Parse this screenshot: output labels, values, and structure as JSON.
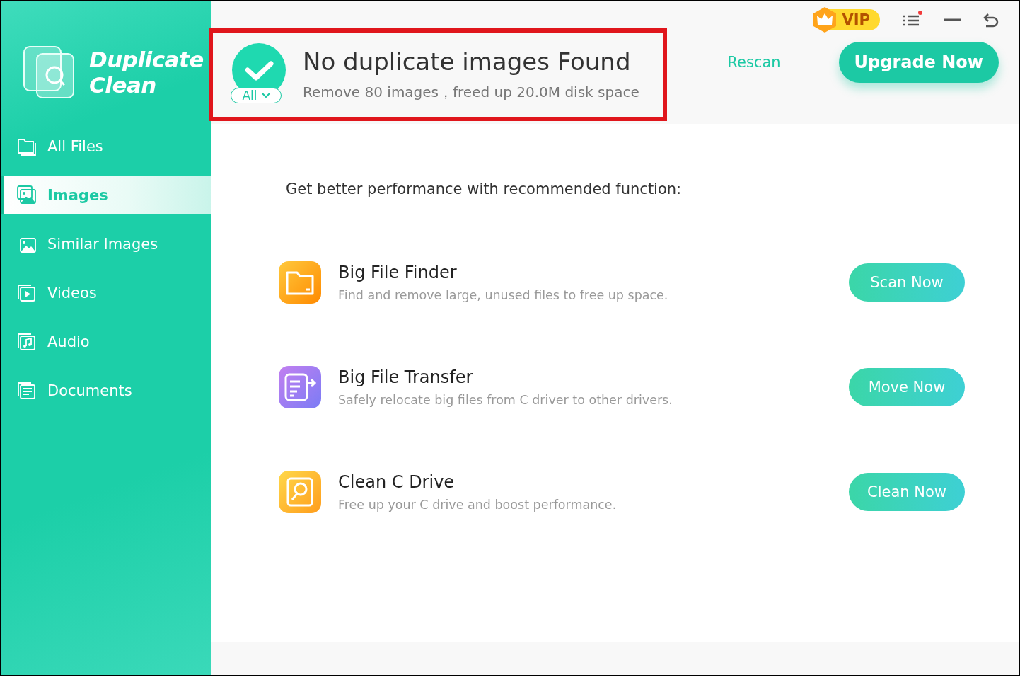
{
  "app": {
    "logo_line1": "Duplicate",
    "logo_line2": "Clean"
  },
  "sidebar": {
    "items": [
      {
        "label": "All Files",
        "kind": "folder",
        "selected": false
      },
      {
        "label": "Images",
        "kind": "images",
        "selected": true
      },
      {
        "label": "Similar Images",
        "kind": "image",
        "selected": false
      },
      {
        "label": "Videos",
        "kind": "video",
        "selected": false
      },
      {
        "label": "Audio",
        "kind": "audio",
        "selected": false
      },
      {
        "label": "Documents",
        "kind": "document",
        "selected": false
      }
    ]
  },
  "status": {
    "title": "No duplicate images Found",
    "subtitle": "Remove 80 images，freed up 20.0M disk space",
    "filter": "All"
  },
  "header": {
    "vip": "VIP",
    "rescan": "Rescan",
    "upgrade": "Upgrade Now"
  },
  "recommend": {
    "heading": "Get better performance with recommended function:",
    "items": [
      {
        "kind": "folder",
        "title": "Big File Finder",
        "description": "Find and remove large, unused files to free up space.",
        "action": "Scan Now"
      },
      {
        "kind": "transfer",
        "title": "Big File Transfer",
        "description": "Safely relocate big files from C driver to other drivers.",
        "action": "Move Now"
      },
      {
        "kind": "drive",
        "title": "Clean C Drive",
        "description": "Free up your C drive and boost performance.",
        "action": "Clean Now"
      }
    ]
  }
}
